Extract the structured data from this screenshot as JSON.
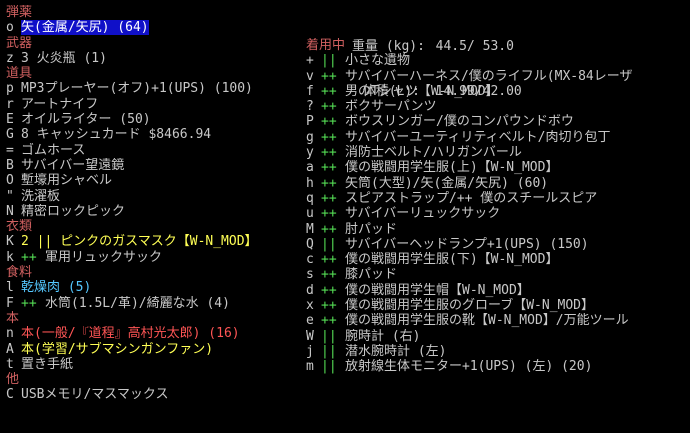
{
  "colors": {
    "category": "#d06060",
    "selected_bg": "#1010c8",
    "green": "#55dd55",
    "yellow": "#ffff55",
    "cyan": "#55c8ff",
    "red": "#ff5555",
    "gray": "#c8c8c8",
    "white": "#ffffff"
  },
  "weight": {
    "weight_label": "重量 (kg):",
    "weight_value": "44.5/ 53.0",
    "volume_label": "体積(L):",
    "volume_value": "14.99/42.00"
  },
  "left": [
    {
      "type": "cat",
      "text": "弾薬"
    },
    {
      "type": "item",
      "key": "o",
      "text": "矢(金属/矢尻) (64)",
      "color": "#ffffff",
      "selected": true
    },
    {
      "type": "cat",
      "text": "武器"
    },
    {
      "type": "item",
      "key": "z",
      "text": "3 火炎瓶 (1)",
      "color": "#c8c8c8"
    },
    {
      "type": "cat",
      "text": "道具"
    },
    {
      "type": "item",
      "key": "p",
      "text": "MP3プレーヤー(オフ)+1(UPS) (100)",
      "color": "#c8c8c8"
    },
    {
      "type": "item",
      "key": "r",
      "text": "アートナイフ",
      "color": "#c8c8c8"
    },
    {
      "type": "item",
      "key": "E",
      "text": "オイルライター (50)",
      "color": "#c8c8c8"
    },
    {
      "type": "item",
      "key": "G",
      "text": "8 キャッシュカード $8466.94",
      "color": "#c8c8c8"
    },
    {
      "type": "item",
      "key": "=",
      "text": "ゴムホース",
      "color": "#c8c8c8"
    },
    {
      "type": "item",
      "key": "B",
      "text": "サバイバー望遠鏡",
      "color": "#c8c8c8"
    },
    {
      "type": "item",
      "key": "O",
      "text": "塹壕用シャベル",
      "color": "#c8c8c8"
    },
    {
      "type": "item",
      "key": "\"",
      "text": "洗濯板",
      "color": "#c8c8c8"
    },
    {
      "type": "item",
      "key": "N",
      "text": "精密ロックピック",
      "color": "#c8c8c8"
    },
    {
      "type": "cat",
      "text": "衣類"
    },
    {
      "type": "item",
      "key": "K",
      "text": "2 || ピンクのガスマスク【W-N_MOD】",
      "color": "#ffff55"
    },
    {
      "type": "item",
      "key": "k",
      "mark": "++",
      "text": "軍用リュックサック",
      "color": "#c8c8c8"
    },
    {
      "type": "cat",
      "text": "食料"
    },
    {
      "type": "item",
      "key": "l",
      "text": "乾燥肉 (5)",
      "color": "#55c8ff"
    },
    {
      "type": "item",
      "key": "F",
      "mark": "++",
      "text": "水筒(1.5L/革)/綺麗な水 (4)",
      "color": "#c8c8c8"
    },
    {
      "type": "cat",
      "text": "本"
    },
    {
      "type": "item",
      "key": "n",
      "text": "本(一般/『道程』高村光太郎) (16)",
      "color": "#ff5555"
    },
    {
      "type": "item",
      "key": "A",
      "text": "本(学習/サブマシンガンファン)",
      "color": "#ffff55"
    },
    {
      "type": "item",
      "key": "t",
      "text": "置き手紙",
      "color": "#c8c8c8"
    },
    {
      "type": "cat",
      "text": "他"
    },
    {
      "type": "item",
      "key": "C",
      "text": "USBメモリ/マスマックス",
      "color": "#c8c8c8"
    }
  ],
  "right": [
    {
      "type": "cat",
      "text": "着用中"
    },
    {
      "key": "+",
      "mark": "||",
      "text": "小さな遺物",
      "color": "#c8c8c8"
    },
    {
      "key": "v",
      "mark": "++",
      "text": "サバイバーハーネス/僕のライフル(MX-84レーザ",
      "color": "#c8c8c8"
    },
    {
      "key": "f",
      "mark": "++",
      "text": "男のTシャツ【W-N_MOD】",
      "color": "#c8c8c8"
    },
    {
      "key": "?",
      "mark": "++",
      "text": "ボクサーパンツ",
      "color": "#c8c8c8"
    },
    {
      "key": "P",
      "mark": "++",
      "text": "ボウスリンガー/僕のコンパウンドボウ",
      "color": "#c8c8c8"
    },
    {
      "key": "g",
      "mark": "++",
      "text": "サバイバーユーティリティベルト/肉切り包丁",
      "color": "#c8c8c8"
    },
    {
      "key": "y",
      "mark": "++",
      "text": "消防士ベルト/ハリガンバール",
      "color": "#c8c8c8"
    },
    {
      "key": "a",
      "mark": "++",
      "text": "僕の戦闘用学生服(上)【W-N_MOD】",
      "color": "#c8c8c8"
    },
    {
      "key": "h",
      "mark": "++",
      "text": "矢筒(大型)/矢(金属/矢尻) (60)",
      "color": "#c8c8c8"
    },
    {
      "key": "q",
      "mark": "++",
      "text": "スピアストラップ/++ 僕のスチールスピア",
      "color": "#c8c8c8"
    },
    {
      "key": "u",
      "mark": "++",
      "text": "サバイバーリュックサック",
      "color": "#c8c8c8"
    },
    {
      "key": "M",
      "mark": "++",
      "text": "肘パッド",
      "color": "#c8c8c8"
    },
    {
      "key": "Q",
      "mark": "||",
      "text": "サバイバーヘッドランプ+1(UPS) (150)",
      "color": "#c8c8c8"
    },
    {
      "key": "c",
      "mark": "++",
      "text": "僕の戦闘用学生服(下)【W-N_MOD】",
      "color": "#c8c8c8"
    },
    {
      "key": "s",
      "mark": "++",
      "text": "膝パッド",
      "color": "#c8c8c8"
    },
    {
      "key": "d",
      "mark": "++",
      "text": "僕の戦闘用学生帽【W-N_MOD】",
      "color": "#c8c8c8"
    },
    {
      "key": "x",
      "mark": "++",
      "text": "僕の戦闘用学生服のグローブ【W-N_MOD】",
      "color": "#c8c8c8"
    },
    {
      "key": "e",
      "mark": "++",
      "text": "僕の戦闘用学生服の靴【W-N_MOD】/万能ツール",
      "color": "#c8c8c8"
    },
    {
      "key": "W",
      "mark": "||",
      "text": "腕時計 (右)",
      "color": "#c8c8c8"
    },
    {
      "key": "j",
      "mark": "||",
      "text": "潜水腕時計 (左)",
      "color": "#c8c8c8"
    },
    {
      "key": "m",
      "mark": "||",
      "text": "放射線生体モニター+1(UPS) (左) (20)",
      "color": "#c8c8c8"
    }
  ]
}
